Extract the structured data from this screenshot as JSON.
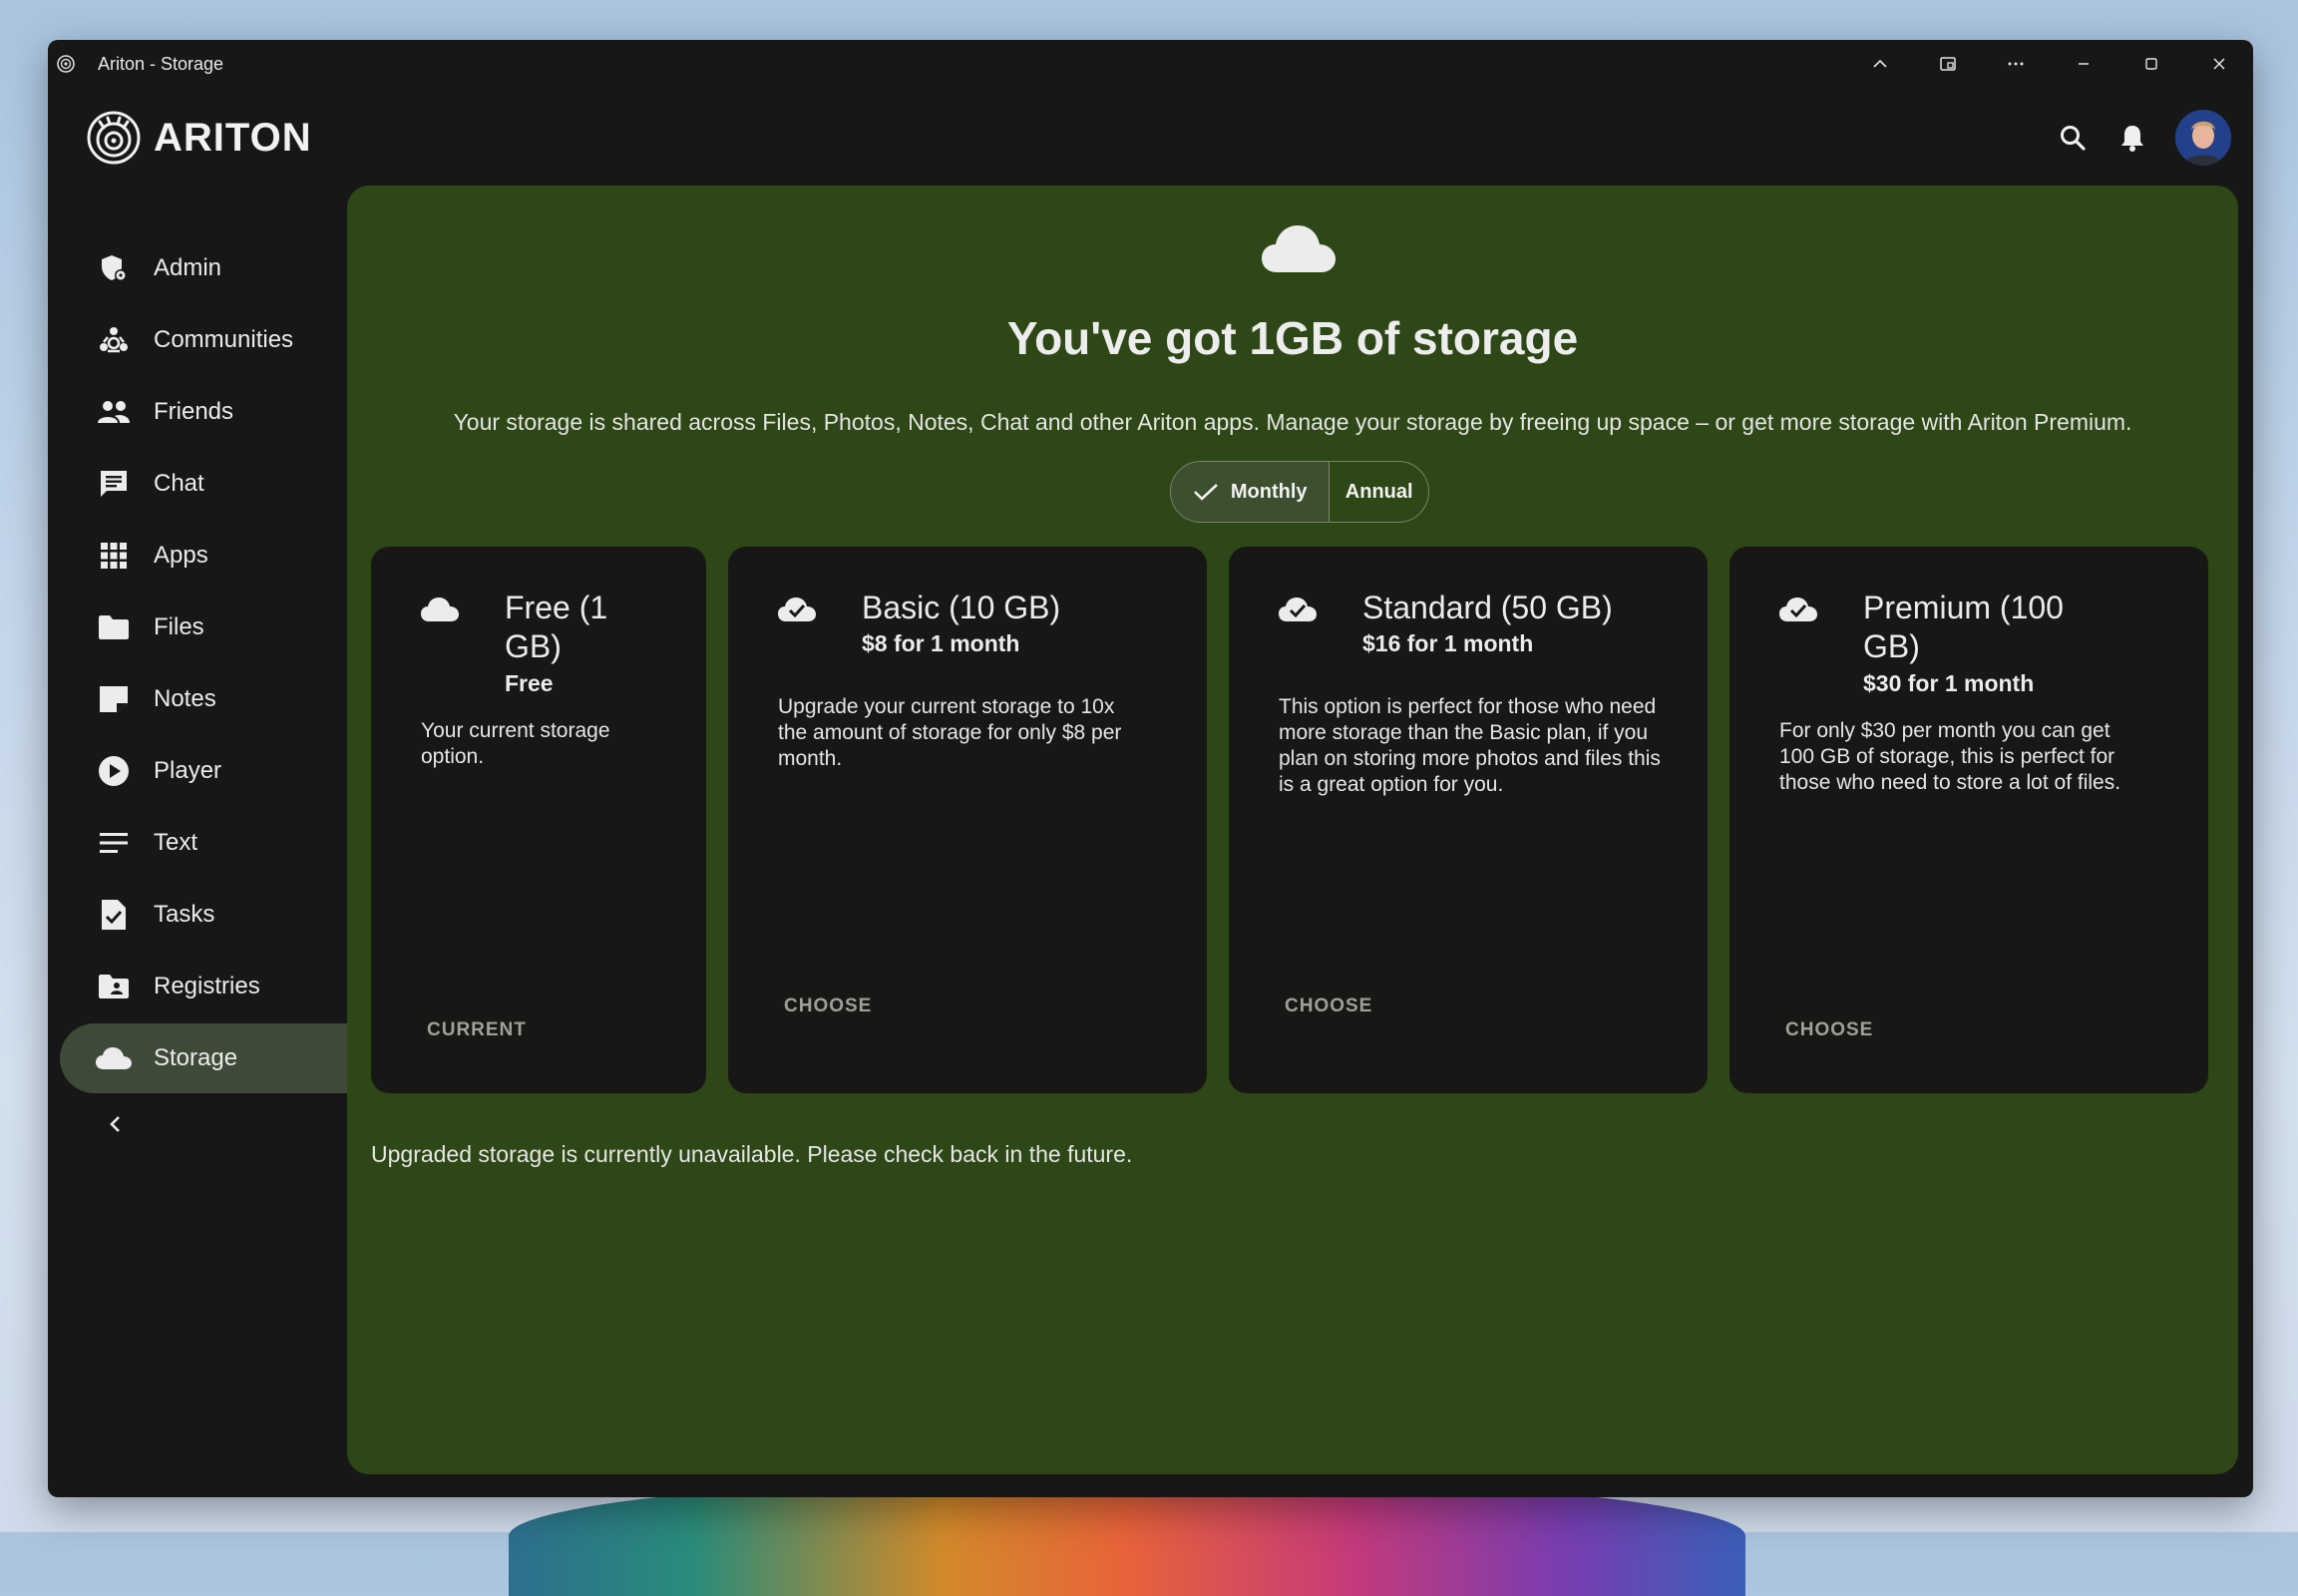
{
  "window": {
    "title": "Ariton - Storage"
  },
  "header": {
    "brand": "ARITON"
  },
  "sidebar": {
    "items": [
      {
        "label": "Admin",
        "icon": "admin-icon"
      },
      {
        "label": "Communities",
        "icon": "communities-icon"
      },
      {
        "label": "Friends",
        "icon": "friends-icon"
      },
      {
        "label": "Chat",
        "icon": "chat-icon"
      },
      {
        "label": "Apps",
        "icon": "apps-icon"
      },
      {
        "label": "Files",
        "icon": "folder-icon"
      },
      {
        "label": "Notes",
        "icon": "notes-icon"
      },
      {
        "label": "Player",
        "icon": "play-icon"
      },
      {
        "label": "Text",
        "icon": "text-icon"
      },
      {
        "label": "Tasks",
        "icon": "tasks-icon"
      },
      {
        "label": "Registries",
        "icon": "registries-icon"
      },
      {
        "label": "Storage",
        "icon": "cloud-icon",
        "active": true
      }
    ]
  },
  "main": {
    "headline": "You've got 1GB of storage",
    "subline": "Your storage is shared across Files, Photos, Notes, Chat and other Ariton apps. Manage your storage by freeing up space – or get more storage with Ariton Premium.",
    "billing_toggle": {
      "monthly": "Monthly",
      "annual": "Annual",
      "selected": "Monthly"
    },
    "plans": [
      {
        "title": "Free (1 GB)",
        "price": "Free",
        "description": "Your current storage option.",
        "action": "CURRENT"
      },
      {
        "title": "Basic (10 GB)",
        "price": "$8 for 1 month",
        "description": "Upgrade your current storage to 10x the amount of storage for only $8 per month.",
        "action": "CHOOSE"
      },
      {
        "title": "Standard (50 GB)",
        "price": "$16 for 1 month",
        "description": "This option is perfect for those who need more storage than the Basic plan, if you plan on storing more photos and files this is a great option for you.",
        "action": "CHOOSE"
      },
      {
        "title": "Premium (100 GB)",
        "price": "$30 for 1 month",
        "description": "For only $30 per month you can get 100 GB of storage, this is perfect for those who need to store a lot of files.",
        "action": "CHOOSE"
      }
    ],
    "notice": "Upgraded storage is currently unavailable. Please check back in the future."
  },
  "colors": {
    "main_bg": "#2e4716",
    "card_bg": "#171816",
    "window_bg": "#161716",
    "active_nav": "#3e4a37"
  }
}
